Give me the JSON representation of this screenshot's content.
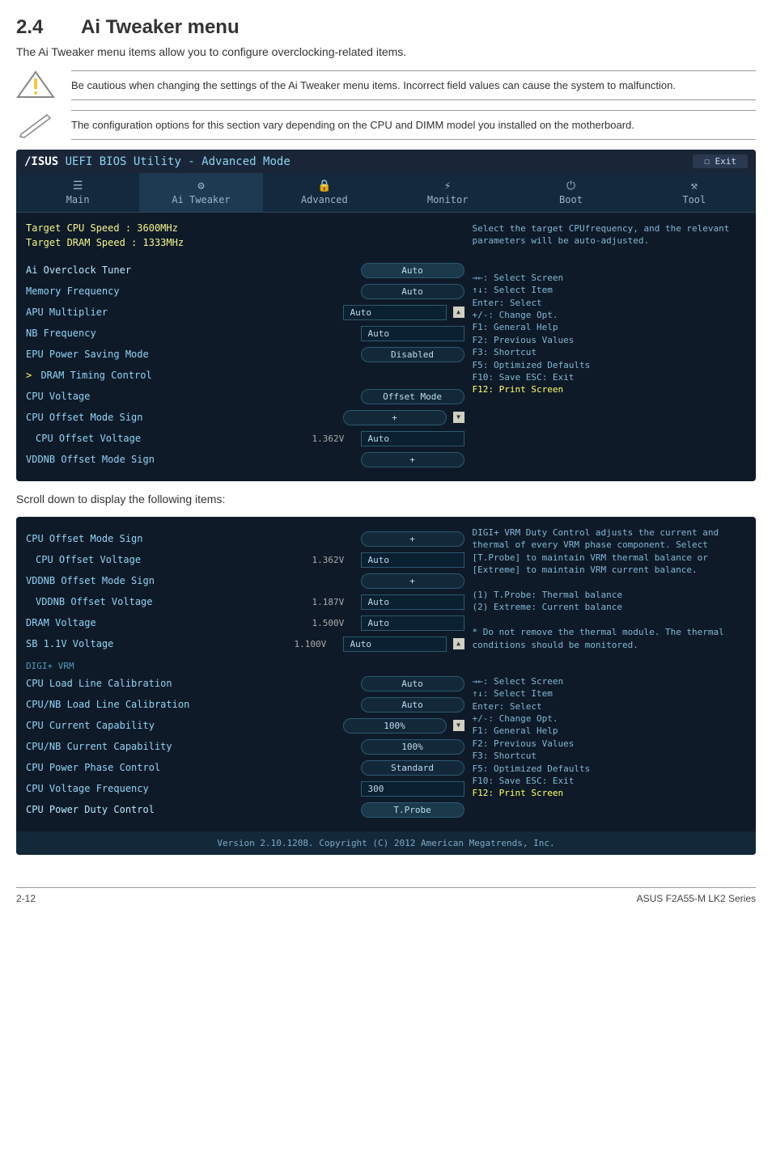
{
  "heading": {
    "num": "2.4",
    "title": "Ai Tweaker menu"
  },
  "intro": "The Ai Tweaker menu items allow you to configure overclocking-related items.",
  "warn": "Be cautious when changing the settings of the Ai Tweaker menu items. Incorrect field values can cause the system to malfunction.",
  "info": "The configuration options for this section vary depending on the CPU and DIMM model you installed on the motherboard.",
  "bios_title_utility": "UEFI BIOS Utility - Advanced Mode",
  "exit": "Exit",
  "tabs": [
    "Main",
    "Ai Tweaker",
    "Advanced",
    "Monitor",
    "Boot",
    "Tool"
  ],
  "tab_icons": [
    "☰",
    "⚙",
    "🔒",
    "⚡",
    "⏻",
    "⚒"
  ],
  "panel1": {
    "targets": [
      "Target CPU Speed : 3600MHz",
      "Target DRAM Speed : 1333MHz"
    ],
    "rows": [
      {
        "label": "Ai Overclock Tuner",
        "type": "pill",
        "val": "Auto",
        "light": true
      },
      {
        "label": "Memory Frequency",
        "type": "pill",
        "val": "Auto"
      },
      {
        "label": "APU Multiplier",
        "type": "input",
        "val": "Auto",
        "scroll": "up"
      },
      {
        "label": "NB Frequency",
        "type": "input",
        "val": "Auto"
      },
      {
        "label": "EPU Power Saving Mode",
        "type": "pill",
        "val": "Disabled"
      },
      {
        "label": "DRAM Timing Control",
        "type": "chev"
      },
      {
        "label": "CPU Voltage",
        "type": "pill",
        "val": "Offset Mode"
      },
      {
        "label": "CPU Offset Mode Sign",
        "type": "pill",
        "val": "+",
        "scroll": "down"
      },
      {
        "label": "CPU Offset Voltage",
        "type": "input",
        "val": "Auto",
        "indent": true,
        "mid": "1.362V"
      },
      {
        "label": "VDDNB Offset Mode Sign",
        "type": "pill",
        "val": "+"
      }
    ],
    "help": "Select the target CPUfrequency, and the relevant parameters will be auto-adjusted.",
    "hotkeys": [
      "→←: Select Screen",
      "↑↓: Select Item",
      "Enter: Select",
      "+/-: Change Opt.",
      "F1: General Help",
      "F2: Previous Values",
      "F3: Shortcut",
      "F5: Optimized Defaults",
      "F10: Save  ESC: Exit"
    ],
    "f12": "F12: Print Screen"
  },
  "mid": "Scroll down to display the following items:",
  "panel2": {
    "rows": [
      {
        "label": "CPU Offset Mode Sign",
        "type": "pill",
        "val": "+"
      },
      {
        "label": "CPU Offset Voltage",
        "type": "input",
        "val": "Auto",
        "indent": true,
        "mid": "1.362V"
      },
      {
        "label": "VDDNB Offset Mode Sign",
        "type": "pill",
        "val": "+"
      },
      {
        "label": "VDDNB Offset Voltage",
        "type": "input",
        "val": "Auto",
        "indent": true,
        "mid": "1.187V"
      },
      {
        "label": "DRAM Voltage",
        "type": "input",
        "val": "Auto",
        "mid": "1.500V"
      },
      {
        "label": "SB 1.1V Voltage",
        "type": "input",
        "val": "Auto",
        "mid": "1.100V",
        "scroll": "up"
      }
    ],
    "section": "DIGI+ VRM",
    "rows2": [
      {
        "label": "CPU Load Line Calibration",
        "type": "pill",
        "val": "Auto"
      },
      {
        "label": "CPU/NB Load Line Calibration",
        "type": "pill",
        "val": "Auto"
      },
      {
        "label": "CPU Current Capability",
        "type": "pill",
        "val": "100%",
        "scroll": "down"
      },
      {
        "label": "CPU/NB Current Capability",
        "type": "pill",
        "val": "100%"
      },
      {
        "label": "CPU Power Phase Control",
        "type": "pill",
        "val": "Standard"
      },
      {
        "label": "CPU Voltage Frequency",
        "type": "input",
        "val": "300"
      },
      {
        "label": "CPU Power Duty Control",
        "type": "pill",
        "val": "T.Probe",
        "light": true
      }
    ],
    "help": "DIGI+ VRM Duty Control adjusts the current and thermal of every VRM phase component. Select [T.Probe] to maintain VRM thermal balance or [Extreme] to maintain VRM current balance.",
    "help2": [
      "(1) T.Probe: Thermal balance",
      "(2) Extreme: Current balance"
    ],
    "help3": "* Do not remove the thermal module. The thermal conditions should be monitored.",
    "hotkeys": [
      "→←: Select Screen",
      "↑↓: Select Item",
      "Enter: Select",
      "+/-: Change Opt.",
      "F1: General Help",
      "F2: Previous Values",
      "F3: Shortcut",
      "F5: Optimized Defaults",
      "F10: Save  ESC: Exit"
    ],
    "f12": "F12: Print Screen",
    "footer": "Version 2.10.1208. Copyright (C) 2012 American Megatrends, Inc."
  },
  "page": {
    "left": "2-12",
    "right": "ASUS F2A55-M LK2 Series"
  }
}
